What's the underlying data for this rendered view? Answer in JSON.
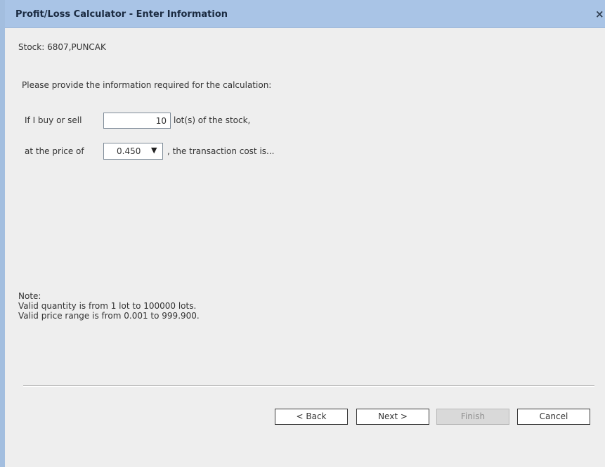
{
  "dialog": {
    "title": "Profit/Loss Calculator - Enter Information",
    "close_icon": "×"
  },
  "stock": {
    "label": "Stock: 6807,PUNCAK"
  },
  "form": {
    "instructions": "Please provide the information required for the calculation:",
    "quantity_prefix": "If I buy or sell",
    "quantity_value": "10",
    "quantity_suffix": "lot(s) of the stock,",
    "price_prefix": "at the price of",
    "price_value": "0.450",
    "price_dropdown_icon": "▼",
    "price_suffix": ", the transaction cost is..."
  },
  "note": {
    "heading": "Note:",
    "line1": "Valid quantity is from 1 lot to 100000 lots.",
    "line2": "Valid price range is from 0.001 to 999.900."
  },
  "buttons": {
    "back": "< Back",
    "next": "Next >",
    "finish": "Finish",
    "cancel": "Cancel"
  }
}
